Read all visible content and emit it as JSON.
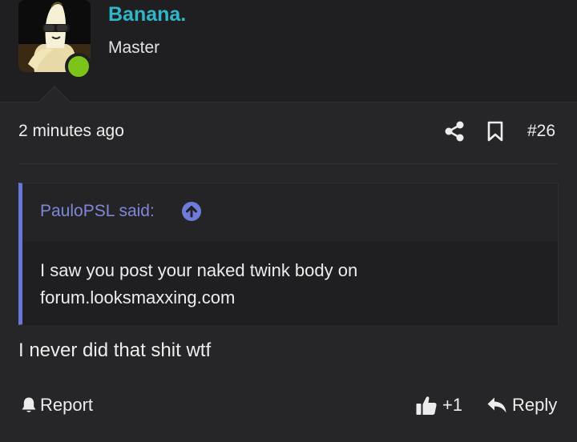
{
  "user": {
    "name": "Banana.",
    "title": "Master",
    "online_color": "#7cc41c",
    "name_color": "#2fb7c9"
  },
  "post": {
    "timestamp": "2 minutes ago",
    "number": "#26",
    "content": "I never did that shit wtf"
  },
  "quote": {
    "author": "PauloPSL said:",
    "text": "I saw you post your naked twink body on forum.looksmaxxing.com",
    "accent_color": "#6a76d6"
  },
  "actions": {
    "report_label": "Report",
    "like_count": "+1",
    "reply_label": "Reply"
  },
  "icons": {
    "share": "share-icon",
    "bookmark": "bookmark-icon",
    "quote_jump": "arrow-up-circle-icon",
    "report": "bell-icon",
    "like": "thumbs-up-icon",
    "reply": "reply-arrow-icon"
  }
}
